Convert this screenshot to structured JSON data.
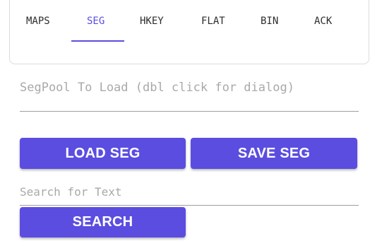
{
  "colors": {
    "accent": "#5b4de0",
    "button_text": "#ffffff",
    "placeholder": "#a9a9a9"
  },
  "tabs": [
    {
      "label": "MAPS",
      "active": false
    },
    {
      "label": "SEG",
      "active": true
    },
    {
      "label": "HKEY",
      "active": false
    },
    {
      "label": "FLAT",
      "active": false
    },
    {
      "label": "BIN",
      "active": false
    },
    {
      "label": "ACK",
      "active": false
    }
  ],
  "segpool": {
    "placeholder": "SegPool To Load (dbl click for dialog)",
    "value": ""
  },
  "buttons": {
    "load_label": "LOAD SEG",
    "save_label": "SAVE SEG",
    "search_label": "SEARCH"
  },
  "search": {
    "placeholder": "Search for Text",
    "value": ""
  }
}
